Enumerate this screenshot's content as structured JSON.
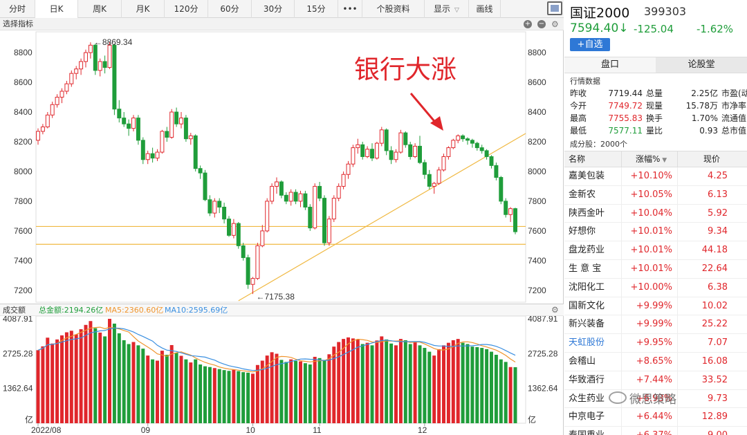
{
  "period_tabs": [
    {
      "label": "分时",
      "width": 51
    },
    {
      "label": "日K",
      "width": 62,
      "active": true
    },
    {
      "label": "周K",
      "width": 63
    },
    {
      "label": "月K",
      "width": 62
    },
    {
      "label": "120分",
      "width": 63
    },
    {
      "label": "60分",
      "width": 63
    },
    {
      "label": "30分",
      "width": 62
    },
    {
      "label": "15分",
      "width": 63
    },
    {
      "label": "•••",
      "width": 35
    },
    {
      "label": "个股资料",
      "width": 90
    },
    {
      "label": "显示",
      "width": 64,
      "caret": true
    },
    {
      "label": "画线",
      "width": 46
    }
  ],
  "indicator_bar": {
    "label": "选择指标"
  },
  "annotation": {
    "text": "银行大涨",
    "color": "#e0262b"
  },
  "volume_bar": {
    "title": "成交额",
    "total_label": "总金额:2194.26亿",
    "ma5_label": "MA5:2360.60亿",
    "ma10_label": "MA10:2595.69亿",
    "total_color": "#1f9d3a",
    "ma5_color": "#f0952d",
    "ma10_color": "#3a8fe0"
  },
  "chart_data": {
    "type": "candlestick",
    "price_axis_ticks": [
      "8800",
      "8600",
      "8400",
      "8200",
      "8000",
      "7800",
      "7600",
      "7400",
      "7200"
    ],
    "price_ticks": [
      8800,
      8600,
      8400,
      8200,
      8000,
      7800,
      7600,
      7400,
      7200
    ],
    "ylim": [
      7120,
      8940
    ],
    "volume_axis_ticks": [
      "4087.91",
      "2725.28",
      "1362.64",
      "亿"
    ],
    "volume_ylim": [
      0,
      4087.91
    ],
    "x_labels": [
      {
        "label": "2022/08",
        "index": 0
      },
      {
        "label": "09",
        "index": 23
      },
      {
        "label": "10",
        "index": 45
      },
      {
        "label": "11",
        "index": 59
      },
      {
        "label": "12",
        "index": 81
      }
    ],
    "high_marker": {
      "label": "8869.34",
      "index": 11,
      "value": 8869.34
    },
    "low_marker": {
      "label": "7175.38",
      "index": 45,
      "value": 7175.38
    },
    "horizontal_lines": [
      7630,
      7510
    ],
    "trend_line": {
      "from": {
        "index": 42,
        "value": 7130
      },
      "to": {
        "index": 104,
        "value": 8290
      }
    },
    "up_color": "#e0262b",
    "down_color": "#1f9d3a",
    "candles": [
      [
        8210,
        8290,
        8180,
        8270,
        2860
      ],
      [
        8270,
        8320,
        8250,
        8300,
        3010
      ],
      [
        8300,
        8400,
        8290,
        8380,
        3350
      ],
      [
        8380,
        8470,
        8360,
        8450,
        3120
      ],
      [
        8450,
        8520,
        8430,
        8500,
        3280
      ],
      [
        8500,
        8560,
        8460,
        8540,
        3440
      ],
      [
        8540,
        8610,
        8520,
        8590,
        3560
      ],
      [
        8590,
        8680,
        8570,
        8660,
        3620
      ],
      [
        8660,
        8710,
        8620,
        8690,
        3480
      ],
      [
        8690,
        8760,
        8650,
        8740,
        3680
      ],
      [
        8740,
        8820,
        8700,
        8800,
        3850
      ],
      [
        8800,
        8869.34,
        8760,
        8850,
        4000
      ],
      [
        8850,
        8860,
        8650,
        8680,
        3720
      ],
      [
        8680,
        8760,
        8640,
        8740,
        3550
      ],
      [
        8740,
        8780,
        8660,
        8700,
        3400
      ],
      [
        8700,
        8870,
        8690,
        8850,
        4087
      ],
      [
        8850,
        8860,
        8380,
        8420,
        3900
      ],
      [
        8420,
        8480,
        8330,
        8360,
        3520
      ],
      [
        8360,
        8400,
        8300,
        8320,
        3250
      ],
      [
        8320,
        8350,
        8240,
        8290,
        3100
      ],
      [
        8290,
        8380,
        8270,
        8360,
        3180
      ],
      [
        8360,
        8380,
        8180,
        8210,
        3050
      ],
      [
        8210,
        8230,
        8050,
        8080,
        2920
      ],
      [
        8080,
        8140,
        8050,
        8120,
        2650
      ],
      [
        8120,
        8160,
        8060,
        8090,
        2500
      ],
      [
        8090,
        8150,
        8070,
        8130,
        2450
      ],
      [
        8130,
        8280,
        8120,
        8270,
        2840
      ],
      [
        8270,
        8300,
        8200,
        8230,
        2680
      ],
      [
        8230,
        8420,
        8220,
        8400,
        3060
      ],
      [
        8400,
        8430,
        8300,
        8320,
        2760
      ],
      [
        8320,
        8400,
        8290,
        8360,
        2640
      ],
      [
        8360,
        8380,
        8200,
        8220,
        2500
      ],
      [
        8220,
        8260,
        8180,
        8240,
        2380
      ],
      [
        8240,
        8250,
        8000,
        8020,
        2500
      ],
      [
        8020,
        8040,
        7950,
        7990,
        2300
      ],
      [
        7990,
        8010,
        7800,
        7810,
        2230
      ],
      [
        7810,
        7840,
        7700,
        7720,
        2200
      ],
      [
        7720,
        7820,
        7690,
        7800,
        2160
      ],
      [
        7800,
        7820,
        7720,
        7760,
        2120
      ],
      [
        7760,
        7790,
        7650,
        7680,
        2080
      ],
      [
        7680,
        7700,
        7560,
        7570,
        2050
      ],
      [
        7570,
        7680,
        7550,
        7650,
        2090
      ],
      [
        7650,
        7660,
        7480,
        7500,
        2040
      ],
      [
        7500,
        7520,
        7400,
        7420,
        2000
      ],
      [
        7420,
        7440,
        7210,
        7240,
        1980
      ],
      [
        7240,
        7290,
        7175.38,
        7280,
        1940
      ],
      [
        7280,
        7520,
        7270,
        7500,
        2280
      ],
      [
        7500,
        7640,
        7490,
        7600,
        2450
      ],
      [
        7600,
        7820,
        7590,
        7800,
        2650
      ],
      [
        7800,
        7920,
        7780,
        7900,
        2780
      ],
      [
        7900,
        7960,
        7850,
        7930,
        2720
      ],
      [
        7930,
        7940,
        7820,
        7840,
        2480
      ],
      [
        7840,
        7860,
        7780,
        7800,
        2400
      ],
      [
        7800,
        7880,
        7770,
        7860,
        2500
      ],
      [
        7860,
        7880,
        7780,
        7800,
        2440
      ],
      [
        7800,
        7870,
        7760,
        7850,
        2420
      ],
      [
        7850,
        7870,
        7740,
        7760,
        2350
      ],
      [
        7760,
        7780,
        7600,
        7620,
        2300
      ],
      [
        7620,
        7920,
        7610,
        7900,
        2600
      ],
      [
        7900,
        7930,
        7800,
        7820,
        2550
      ],
      [
        7820,
        7840,
        7500,
        7520,
        2480
      ],
      [
        7520,
        7700,
        7500,
        7680,
        2700
      ],
      [
        7680,
        7840,
        7660,
        7820,
        3000
      ],
      [
        7820,
        7920,
        7800,
        7900,
        3180
      ],
      [
        7900,
        8000,
        7880,
        7980,
        3300
      ],
      [
        7980,
        8070,
        7950,
        8050,
        3360
      ],
      [
        8050,
        8180,
        8030,
        8160,
        3320
      ],
      [
        8160,
        8220,
        8120,
        8180,
        3280
      ],
      [
        8180,
        8200,
        8080,
        8100,
        3100
      ],
      [
        8100,
        8170,
        8090,
        8150,
        3150
      ],
      [
        8150,
        8190,
        8070,
        8090,
        3050
      ],
      [
        8090,
        8200,
        8080,
        8190,
        3240
      ],
      [
        8190,
        8300,
        8170,
        8280,
        3400
      ],
      [
        8280,
        8290,
        8110,
        8140,
        3280
      ],
      [
        8140,
        8170,
        8050,
        8080,
        3120
      ],
      [
        8080,
        8150,
        8060,
        8130,
        3050
      ],
      [
        8130,
        8280,
        8120,
        8260,
        3300
      ],
      [
        8260,
        8270,
        8160,
        8180,
        3250
      ],
      [
        8180,
        8200,
        8080,
        8100,
        3100
      ],
      [
        8100,
        8190,
        8090,
        8170,
        3180
      ],
      [
        8170,
        8240,
        8050,
        8060,
        3050
      ],
      [
        8060,
        8080,
        7950,
        7980,
        2950
      ],
      [
        7980,
        8010,
        7880,
        7900,
        2800
      ],
      [
        7900,
        7930,
        7850,
        7920,
        2650
      ],
      [
        7920,
        8030,
        7910,
        8010,
        2900
      ],
      [
        8010,
        8120,
        8000,
        8100,
        3050
      ],
      [
        8100,
        8170,
        8080,
        8160,
        3150
      ],
      [
        8160,
        8220,
        8150,
        8210,
        3250
      ],
      [
        8210,
        8250,
        8190,
        8240,
        3300
      ],
      [
        8240,
        8250,
        8200,
        8220,
        3150
      ],
      [
        8220,
        8230,
        8180,
        8210,
        3100
      ],
      [
        8210,
        8220,
        8160,
        8190,
        3000
      ],
      [
        8190,
        8200,
        8140,
        8160,
        2980
      ],
      [
        8160,
        8180,
        8120,
        8140,
        2950
      ],
      [
        8140,
        8150,
        8080,
        8100,
        2900
      ],
      [
        8100,
        8110,
        8020,
        8040,
        2800
      ],
      [
        8040,
        8060,
        7940,
        7960,
        2680
      ],
      [
        7960,
        7970,
        7780,
        7800,
        2500
      ],
      [
        7800,
        7820,
        7690,
        7710,
        2400
      ],
      [
        7710,
        7760,
        7660,
        7750,
        2200
      ],
      [
        7750,
        7755.83,
        7577.11,
        7594.4,
        2194
      ]
    ]
  },
  "quote": {
    "name": "国证2000",
    "code": "399303",
    "price": "7594.40↓",
    "change": "-125.04",
    "change_pct": "-1.62%",
    "add_button": "+自选",
    "tabs": [
      "盘口",
      "论股堂"
    ],
    "section_title": "行情数据",
    "rows": [
      {
        "k1": "昨收",
        "v1": "7719.44",
        "c1": "",
        "k2": "总量",
        "v2": "2.25亿",
        "k3": "市盈(动"
      },
      {
        "k1": "今开",
        "v1": "7749.72",
        "c1": "red",
        "k2": "现量",
        "v2": "15.78万",
        "k3": "市净率"
      },
      {
        "k1": "最高",
        "v1": "7755.83",
        "c1": "red",
        "k2": "换手",
        "v2": "1.70%",
        "k3": "流通值"
      },
      {
        "k1": "最低",
        "v1": "7577.11",
        "c1": "green",
        "k2": "量比",
        "v2": "0.93",
        "k3": "总市值"
      }
    ],
    "component_title": "成分股：2000个",
    "list_headers": {
      "name": "名称",
      "pct": "涨幅%",
      "price": "现价"
    },
    "list": [
      {
        "name": "嘉美包装",
        "pct": "+10.10%",
        "price": "4.25"
      },
      {
        "name": "金新农",
        "pct": "+10.05%",
        "price": "6.13"
      },
      {
        "name": "陕西金叶",
        "pct": "+10.04%",
        "price": "5.92"
      },
      {
        "name": "好想你",
        "pct": "+10.01%",
        "price": "9.34"
      },
      {
        "name": "盘龙药业",
        "pct": "+10.01%",
        "price": "44.18"
      },
      {
        "name": "生 意 宝",
        "pct": "+10.01%",
        "price": "22.64"
      },
      {
        "name": "沈阳化工",
        "pct": "+10.00%",
        "price": "6.38"
      },
      {
        "name": "国新文化",
        "pct": "+9.99%",
        "price": "10.02"
      },
      {
        "name": "新兴装备",
        "pct": "+9.99%",
        "price": "25.22"
      },
      {
        "name": "天虹股份",
        "pct": "+9.95%",
        "price": "7.07",
        "blue": true
      },
      {
        "name": "会稽山",
        "pct": "+8.65%",
        "price": "16.08"
      },
      {
        "name": "华致酒行",
        "pct": "+7.44%",
        "price": "33.52"
      },
      {
        "name": "众生药业",
        "pct": "+6.93%",
        "price": "9.73"
      },
      {
        "name": "中京电子",
        "pct": "+6.44%",
        "price": "12.89"
      },
      {
        "name": "泰国重业",
        "pct": "+6.37%",
        "price": "9.00"
      }
    ]
  },
  "watermark": "微思策略"
}
